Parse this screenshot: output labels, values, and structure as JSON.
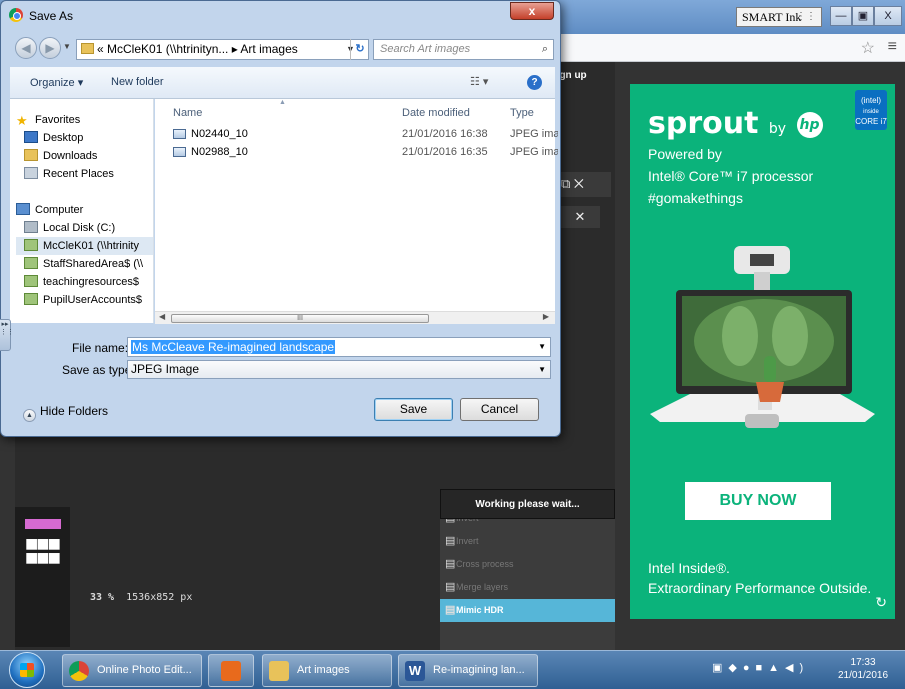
{
  "window": {
    "smart_ink_label": "SMART Ink",
    "minimize": "—",
    "restore": "▣",
    "close": "X"
  },
  "background_app": {
    "signup_label": "Sign up",
    "panel_a_icon": "⧉ ✕",
    "panel_b_close": "✕",
    "zoom_value": "33",
    "zoom_unit": "%",
    "canvas_size": "1536x852 px",
    "working_text": "Working please wait...",
    "filters": [
      {
        "label": "Invert"
      },
      {
        "label": "Invert"
      },
      {
        "label": "Cross process"
      },
      {
        "label": "Merge layers"
      },
      {
        "label": "Mimic HDR"
      }
    ]
  },
  "ad": {
    "brand": "sprout",
    "by": "by",
    "hp": "hp",
    "intel_badge": "intel inside CORE i7",
    "powered_by": "Powered by",
    "processor": "Intel® Core™ i7 processor",
    "hashtag": "#gomakethings",
    "cta": "BUY NOW",
    "tagline1": "Intel Inside®.",
    "tagline2": "Extraordinary Performance Outside.",
    "accent_color": "#0bb37b"
  },
  "dialog": {
    "title": "Save As",
    "close_label": "x",
    "address_path": "« McCleK01 (\\\\htrinityn... ▸ Art images",
    "search_placeholder": "Search Art images",
    "organize_label": "Organize ▾",
    "new_folder_label": "New folder",
    "nav": {
      "favorites": "Favorites",
      "desktop": "Desktop",
      "downloads": "Downloads",
      "recent_places": "Recent Places",
      "computer": "Computer",
      "local_disk": "Local Disk (C:)",
      "drive1": "McCleK01 (\\\\htrinity",
      "drive2": "StaffSharedArea$ (\\\\",
      "drive3": "teachingresources$",
      "drive4": "PupilUserAccounts$"
    },
    "columns": {
      "name": "Name",
      "date_modified": "Date modified",
      "type": "Type"
    },
    "files": [
      {
        "name": "N02440_10",
        "date": "21/01/2016 16:38",
        "type": "JPEG image"
      },
      {
        "name": "N02988_10",
        "date": "21/01/2016 16:35",
        "type": "JPEG image"
      }
    ],
    "scroll_grip": "III",
    "file_name_label": "File name:",
    "file_name_value": "Ms McCleave Re-imagined landscape",
    "save_type_label": "Save as type:",
    "save_type_value": "JPEG Image",
    "hide_folders_label": "Hide Folders",
    "save_label": "Save",
    "cancel_label": "Cancel"
  },
  "taskbar": {
    "items": [
      {
        "label": "Online Photo Edit..."
      },
      {
        "label": ""
      },
      {
        "label": "Art images"
      },
      {
        "label": "Re-imagining lan..."
      }
    ],
    "time": "17:33",
    "date": "21/01/2016"
  }
}
